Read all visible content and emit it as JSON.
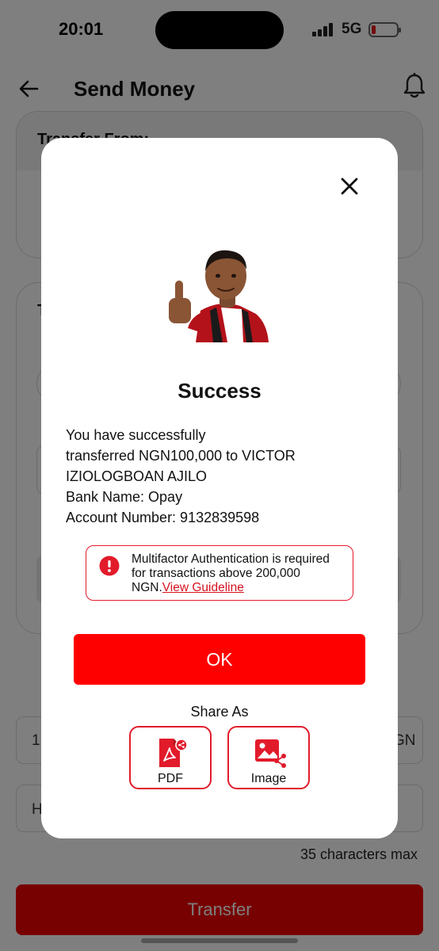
{
  "status_bar": {
    "time": "20:01",
    "network": "5G"
  },
  "header": {
    "title": "Send Money"
  },
  "background_form": {
    "transfer_from_label": "Transfer From:",
    "transfer_to_label": "T",
    "amount_value_prefix": "1",
    "amount_currency_suffix": "GN",
    "narration_prefix": "H",
    "char_limit_hint": "35 characters max",
    "transfer_button_label": "Transfer"
  },
  "modal": {
    "title": "Success",
    "message_lines": [
      "You have successfully",
      "transferred NGN100,000 to VICTOR",
      "IZIOLOGBOAN AJILO",
      "Bank Name: Opay",
      "Account Number: 9132839598"
    ],
    "notice": {
      "text": "Multifactor Authentication is required for transactions above 200,000 NGN.",
      "link_label": "View Guideline"
    },
    "ok_label": "OK",
    "share_label": "Share As",
    "share_options": [
      {
        "label": "PDF",
        "icon": "pdf-share-icon"
      },
      {
        "label": "Image",
        "icon": "image-share-icon"
      }
    ]
  },
  "colors": {
    "accent": "#ff0000",
    "alert_border": "#e21b2b",
    "link": "#d7121f",
    "battery_low": "#e21b1b"
  },
  "battery_level": 0.15
}
